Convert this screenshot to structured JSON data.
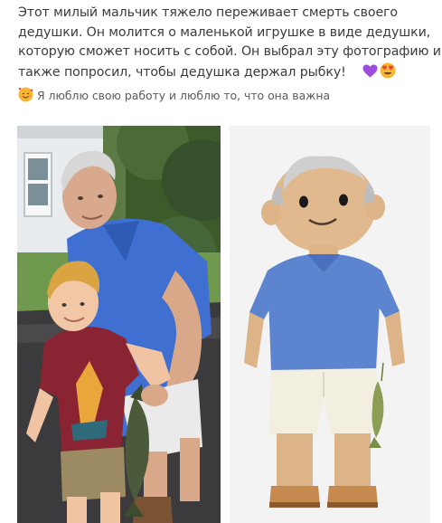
{
  "post": {
    "caption_lines": [
      "Этот милый мальчик тяжело переживает смерть своего",
      "дедушки. Он молится о маленькой игрушке в виде дедушки,",
      "которую сможет носить с собой. Он выбрал эту фотографию и",
      "также попросил, чтобы дедушка держал рыбку!"
    ],
    "caption_emojis": [
      "purple-heart-icon",
      "heart-eyes-face-icon"
    ],
    "reply_text": "Я люблю свою работу и люблю то, что она важна",
    "reply_emoji": "smiling-face-with-hearts-icon"
  },
  "images": {
    "left": "photo-grandfather-and-boy-with-fish",
    "right": "photo-crochet-grandfather-doll-holding-fish"
  },
  "colors": {
    "shirt_blue": "#3f6fd0",
    "doll_blue": "#5d84cf",
    "boy_shirt": "#8a2433",
    "purple_heart": "#9b4ddb"
  }
}
